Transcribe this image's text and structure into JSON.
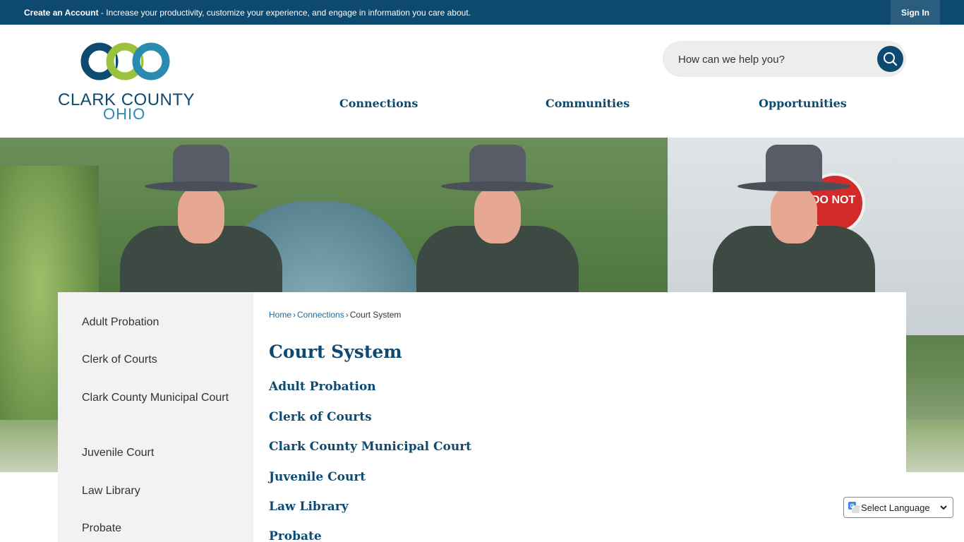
{
  "topbar": {
    "create_account": "Create an Account",
    "message": " - Increase your productivity, customize your experience, and engage in information you care about.",
    "sign_in": "Sign In"
  },
  "logo": {
    "line1": "CLARK COUNTY",
    "line2": "OHIO",
    "letters": "CCO"
  },
  "search": {
    "placeholder": "How can we help you?",
    "icon": "search-icon"
  },
  "nav": {
    "items": [
      "Connections",
      "Communities",
      "Opportunities"
    ]
  },
  "sidebar": {
    "items": [
      "Adult Probation",
      "Clerk of Courts",
      "Clark County Municipal Court",
      "Juvenile Court",
      "Law Library",
      "Probate"
    ]
  },
  "breadcrumb": {
    "home": "Home",
    "connections": "Connections",
    "current": "Court System",
    "separator": "›"
  },
  "main": {
    "title": "Court System",
    "links": [
      "Adult Probation",
      "Clerk of Courts",
      "Clark County Municipal Court",
      "Juvenile Court",
      "Law Library",
      "Probate"
    ]
  },
  "language": {
    "label": "Select Language"
  },
  "colors": {
    "brand_navy": "#0e4a70",
    "brand_green": "#9bc23c",
    "brand_teal": "#2a8ab0"
  },
  "hero": {
    "sign_text": "DO NOT"
  }
}
